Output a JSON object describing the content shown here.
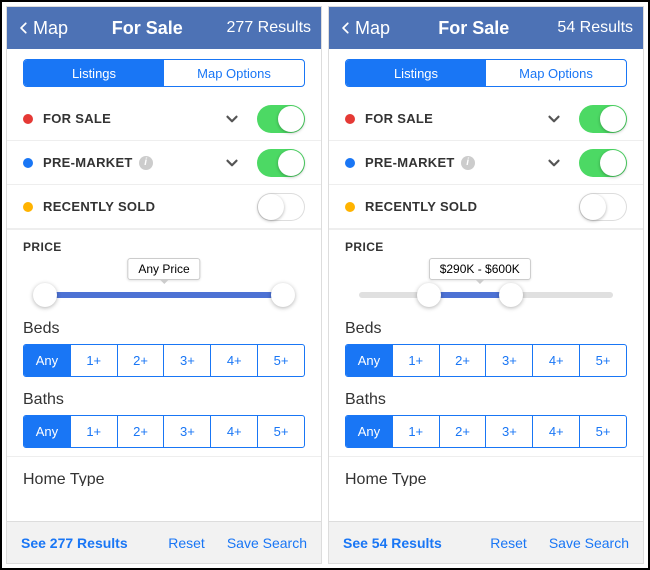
{
  "screens": [
    {
      "header": {
        "back": "Map",
        "title": "For Sale",
        "results": "277 Results"
      },
      "segments": {
        "listings": "Listings",
        "mapOptions": "Map Options"
      },
      "filters": {
        "forSale": {
          "label": "FOR SALE",
          "dot": "#e53935",
          "on": true
        },
        "preMarket": {
          "label": "PRE-MARKET",
          "dot": "#1976f5",
          "on": true,
          "info": true
        },
        "recentlySold": {
          "label": "RECENTLY SOLD",
          "dot": "#ffb300",
          "on": false
        }
      },
      "price": {
        "section": "PRICE",
        "tooltip": "Any Price",
        "fillLeftPct": 12,
        "fillRightPct": 88,
        "tooltipPct": 50
      },
      "beds": {
        "label": "Beds",
        "options": [
          "Any",
          "1+",
          "2+",
          "3+",
          "4+",
          "5+"
        ],
        "selected": 0
      },
      "baths": {
        "label": "Baths",
        "options": [
          "Any",
          "1+",
          "2+",
          "3+",
          "4+",
          "5+"
        ],
        "selected": 0
      },
      "peek": "Home Type",
      "footer": {
        "primary": "See 277 Results",
        "reset": "Reset",
        "save": "Save Search"
      }
    },
    {
      "header": {
        "back": "Map",
        "title": "For Sale",
        "results": "54 Results"
      },
      "segments": {
        "listings": "Listings",
        "mapOptions": "Map Options"
      },
      "filters": {
        "forSale": {
          "label": "FOR SALE",
          "dot": "#e53935",
          "on": true
        },
        "preMarket": {
          "label": "PRE-MARKET",
          "dot": "#1976f5",
          "on": true,
          "info": true
        },
        "recentlySold": {
          "label": "RECENTLY SOLD",
          "dot": "#ffb300",
          "on": false
        }
      },
      "price": {
        "section": "PRICE",
        "tooltip": "$290K - $600K",
        "fillLeftPct": 32,
        "fillRightPct": 58,
        "tooltipPct": 48
      },
      "beds": {
        "label": "Beds",
        "options": [
          "Any",
          "1+",
          "2+",
          "3+",
          "4+",
          "5+"
        ],
        "selected": 0
      },
      "baths": {
        "label": "Baths",
        "options": [
          "Any",
          "1+",
          "2+",
          "3+",
          "4+",
          "5+"
        ],
        "selected": 0
      },
      "peek": "Home Type",
      "footer": {
        "primary": "See 54 Results",
        "reset": "Reset",
        "save": "Save Search"
      }
    }
  ]
}
